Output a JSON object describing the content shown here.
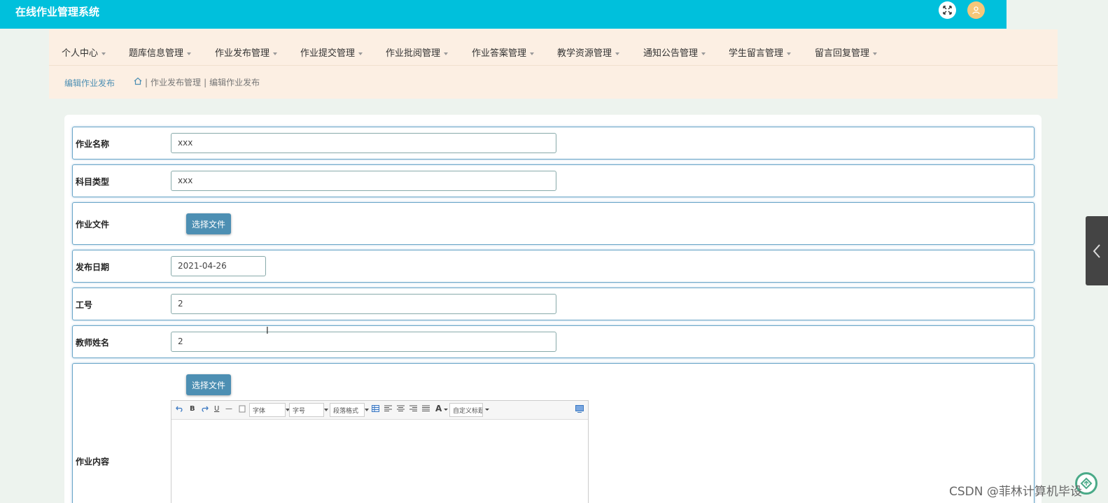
{
  "app": {
    "title": "在线作业管理系统"
  },
  "header": {
    "expand_icon": "expand-icon",
    "user_icon": "user-icon"
  },
  "nav": {
    "items": [
      {
        "label": "个人中心"
      },
      {
        "label": "题库信息管理"
      },
      {
        "label": "作业发布管理"
      },
      {
        "label": "作业提交管理"
      },
      {
        "label": "作业批阅管理"
      },
      {
        "label": "作业答案管理"
      },
      {
        "label": "教学资源管理"
      },
      {
        "label": "通知公告管理"
      },
      {
        "label": "学生留言管理"
      },
      {
        "label": "留言回复管理"
      }
    ]
  },
  "breadcrumb": {
    "current": "编辑作业发布",
    "sep1": "|",
    "level1": "作业发布管理",
    "sep2": "|",
    "level2": "编辑作业发布"
  },
  "form": {
    "homework_name": {
      "label": "作业名称",
      "value": "xxx"
    },
    "subject_type": {
      "label": "科目类型",
      "value": "xxx"
    },
    "homework_file": {
      "label": "作业文件",
      "button": "选择文件"
    },
    "publish_date": {
      "label": "发布日期",
      "value": "2021-04-26"
    },
    "staff_id": {
      "label": "工号",
      "value": "2"
    },
    "teacher_name": {
      "label": "教师姓名",
      "value": "2"
    },
    "homework_content": {
      "label": "作业内容",
      "button": "选择文件",
      "toolbar": {
        "bold": "B",
        "underline": "U",
        "dash": "—",
        "font": "字体",
        "size": "字号",
        "paragraph": "段落格式",
        "font_color": "A",
        "custom_title": "自定义标题"
      }
    }
  },
  "watermark": "CSDN @菲林计算机毕设"
}
